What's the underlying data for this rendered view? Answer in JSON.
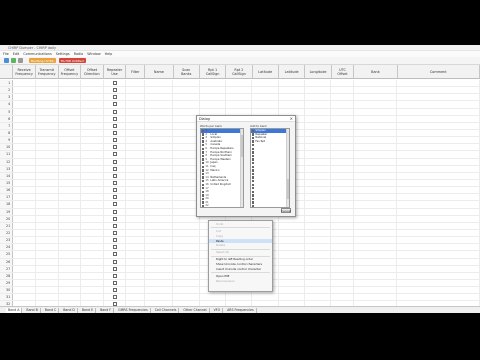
{
  "window": {
    "title": "CHIRP Dumper - CHIRP daily",
    "menus": [
      "File",
      "Edit",
      "Communications",
      "Settings",
      "Radio",
      "Window",
      "Help"
    ]
  },
  "toolbar": {
    "doc_tabs": [
      {
        "label": "Baofeng UV-5R",
        "color": "#e8a33c"
      },
      {
        "label": "TK-708 Untitled",
        "color": "#d6453a"
      }
    ]
  },
  "columns": [
    "Receive\nFrequency",
    "Transmit\nFrequency",
    "Offset\nFrequency",
    "Offset\nDirection",
    "Repeater\nUse",
    "Filter",
    "Name",
    "Scan\nBanks",
    "Rpt 1\nCallSign",
    "Rpt 2\nCallSign",
    "Latitude",
    "Latitude",
    "Longitude",
    "UTC\nOffset",
    "Bank",
    "Comment"
  ],
  "row_numbers": [
    "1",
    "2",
    "3",
    "4",
    "5",
    "6",
    "7",
    "8",
    "9",
    "10",
    "11",
    "12",
    "13",
    "14",
    "15",
    "16",
    "17",
    "18",
    "19",
    "20",
    "21",
    "22",
    "23",
    "24",
    "25",
    "26",
    "27",
    "28",
    "29",
    "30",
    "31",
    "32",
    "33"
  ],
  "sheet_tabs": [
    "Band A",
    "Band B",
    "Band C",
    "Band D",
    "Band E",
    "Band F",
    "GMRS Frequencies",
    "Call Channels",
    "Other Channel",
    "VFO",
    "ARS Frequencies"
  ],
  "dialog": {
    "title": "Dialog",
    "left_label": "Words per bank",
    "right_label": "Add to bank",
    "left_items": [
      {
        "num": "1",
        "text": "",
        "selected": true
      },
      {
        "num": "2",
        "text": "Local"
      },
      {
        "num": "3",
        "text": "Simplex"
      },
      {
        "num": "4",
        "text": "Australia"
      },
      {
        "num": "5",
        "text": "Canada"
      },
      {
        "num": "6",
        "text": "Europe Repeaters"
      },
      {
        "num": "7",
        "text": "Europe Northern"
      },
      {
        "num": "8",
        "text": "Europe Southern"
      },
      {
        "num": "9",
        "text": "Europe Western"
      },
      {
        "num": "10",
        "text": "Japan"
      },
      {
        "num": "11",
        "text": "Iraq"
      },
      {
        "num": "12",
        "text": "Mexico"
      },
      {
        "num": "13",
        "text": ""
      },
      {
        "num": "14",
        "text": "Netherlands"
      },
      {
        "num": "15",
        "text": "Latin America"
      },
      {
        "num": "16",
        "text": "United Kingdom"
      },
      {
        "num": "17",
        "text": ""
      },
      {
        "num": "18",
        "text": ""
      },
      {
        "num": "19",
        "text": ""
      },
      {
        "num": "20",
        "text": ""
      },
      {
        "num": "21",
        "text": ""
      },
      {
        "num": "22",
        "text": ""
      },
      {
        "num": "23",
        "text": "USA Northeast"
      },
      {
        "num": "24",
        "text": "USA Southeast"
      },
      {
        "num": "25",
        "text": "USA Southwest"
      },
      {
        "num": "26",
        "text": ""
      },
      {
        "num": "27",
        "text": ""
      }
    ],
    "right_items": [
      {
        "num": "",
        "text": "Simplex",
        "selected": true
      },
      {
        "num": "",
        "text": "Repeater"
      },
      {
        "num": "",
        "text": "National"
      },
      {
        "num": "",
        "text": "Fav Rpt"
      },
      {
        "num": "",
        "text": ""
      },
      {
        "num": "",
        "text": ""
      },
      {
        "num": "",
        "text": ""
      },
      {
        "num": "",
        "text": ""
      },
      {
        "num": "",
        "text": ""
      },
      {
        "num": "",
        "text": ""
      },
      {
        "num": "",
        "text": ""
      },
      {
        "num": "",
        "text": ""
      },
      {
        "num": "",
        "text": ""
      },
      {
        "num": "",
        "text": ""
      },
      {
        "num": "",
        "text": ""
      },
      {
        "num": "",
        "text": ""
      },
      {
        "num": "",
        "text": ""
      },
      {
        "num": "",
        "text": ""
      },
      {
        "num": "",
        "text": ""
      },
      {
        "num": "",
        "text": ""
      },
      {
        "num": "",
        "text": ""
      },
      {
        "num": "",
        "text": ""
      },
      {
        "num": "",
        "text": ""
      },
      {
        "num": "",
        "text": ""
      },
      {
        "num": "",
        "text": ""
      },
      {
        "num": "",
        "text": ""
      }
    ],
    "button_label": "Cancel"
  },
  "context_menu": {
    "items": [
      {
        "label": "Undo",
        "disabled": true
      },
      {
        "sep": true
      },
      {
        "label": "Cut",
        "disabled": true
      },
      {
        "label": "Copy",
        "disabled": true
      },
      {
        "label": "Paste",
        "highlight": true
      },
      {
        "label": "Delete",
        "disabled": true
      },
      {
        "sep": true
      },
      {
        "label": "Select All",
        "disabled": true
      },
      {
        "sep": true
      },
      {
        "label": "Right to left Reading order"
      },
      {
        "label": "Show Unicode control characters"
      },
      {
        "label": "Insert Unicode control character"
      },
      {
        "sep": true
      },
      {
        "label": "Open IME"
      },
      {
        "label": "Reconversion",
        "disabled": true
      }
    ]
  }
}
